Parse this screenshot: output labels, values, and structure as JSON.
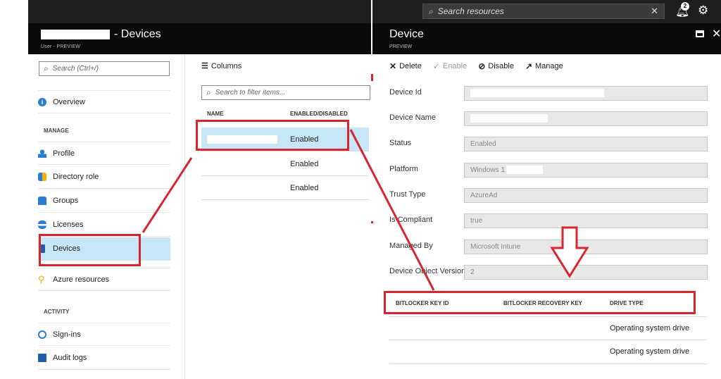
{
  "left_blade": {
    "title": "- Devices",
    "subtitle": "User - PREVIEW",
    "search_placeholder": "Search (Ctrl+/)",
    "overview": "Overview",
    "manage_section": "MANAGE",
    "activity_section": "ACTIVITY",
    "items": [
      {
        "label": "Profile",
        "icon": "person-icon"
      },
      {
        "label": "Directory role",
        "icon": "directory-role-icon"
      },
      {
        "label": "Groups",
        "icon": "groups-icon"
      },
      {
        "label": "Licenses",
        "icon": "license-icon"
      },
      {
        "label": "Devices",
        "icon": "device-icon"
      },
      {
        "label": "Azure resources",
        "icon": "key-icon"
      }
    ],
    "activity_items": [
      {
        "label": "Sign-ins",
        "icon": "sign-in-icon"
      },
      {
        "label": "Audit logs",
        "icon": "audit-log-icon"
      }
    ]
  },
  "devices_list": {
    "columns_label": "Columns",
    "filter_placeholder": "Search to filter items...",
    "headers": [
      "NAME",
      "ENABLED/DISABLED"
    ],
    "rows": [
      {
        "name": "",
        "status": "Enabled"
      },
      {
        "name": "",
        "status": "Enabled"
      },
      {
        "name": "",
        "status": "Enabled"
      }
    ]
  },
  "top_bar": {
    "search_placeholder": "Search resources",
    "notifications_count": "2"
  },
  "device_blade": {
    "title": "Device",
    "subtitle": "PREVIEW",
    "toolbar": {
      "delete": "Delete",
      "enable": "Enable",
      "disable": "Disable",
      "manage": "Manage"
    },
    "fields": [
      {
        "label": "Device Id",
        "value": ""
      },
      {
        "label": "Device Name",
        "value": ""
      },
      {
        "label": "Status",
        "value": "Enabled"
      },
      {
        "label": "Platform",
        "value": "Windows 1"
      },
      {
        "label": "Trust Type",
        "value": "AzureAd"
      },
      {
        "label": "Is Compliant",
        "value": "true"
      },
      {
        "label": "Managed By",
        "value": "Microsoft Intune"
      },
      {
        "label": "Device Object Version",
        "value": "2"
      }
    ],
    "bitlocker_headers": [
      "BITLOCKER KEY ID",
      "BITLOCKER RECOVERY KEY",
      "DRIVE TYPE"
    ],
    "bitlocker_rows": [
      {
        "key_id": "",
        "recovery_key": "",
        "drive_type": "Operating system drive"
      },
      {
        "key_id": "",
        "recovery_key": "",
        "drive_type": "Operating system drive"
      }
    ]
  },
  "colors": {
    "annotation_red": "#d9262e",
    "selection_blue": "#c7e6f8",
    "header_black": "#0a0a0a"
  }
}
